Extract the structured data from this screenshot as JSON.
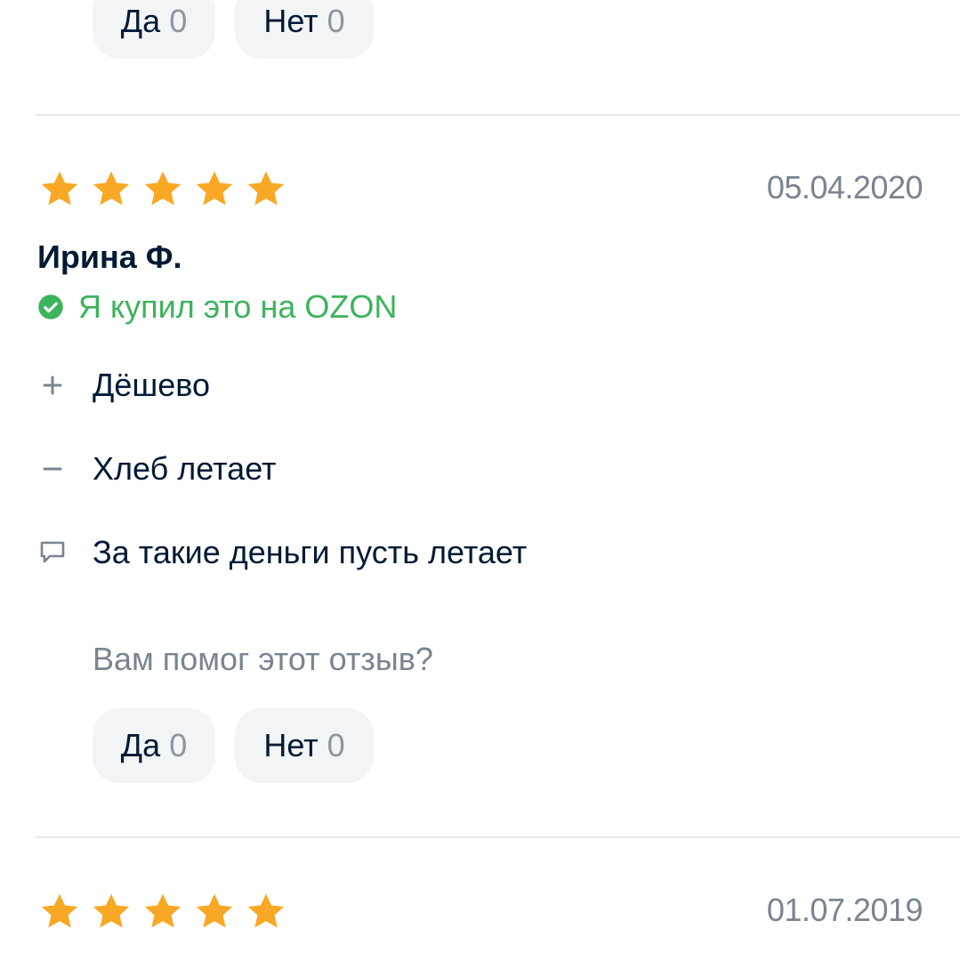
{
  "top_votes": {
    "yes_label": "Да",
    "yes_count": "0",
    "no_label": "Нет",
    "no_count": "0"
  },
  "review": {
    "rating": 5,
    "date": "05.04.2020",
    "author": "Ирина Ф.",
    "verified_text": "Я купил это на OZON",
    "pros": "Дёшево",
    "cons": "Хлеб летает",
    "comment": "За такие деньги пусть летает",
    "helpful_question": "Вам помог этот отзыв?",
    "yes_label": "Да",
    "yes_count": "0",
    "no_label": "Нет",
    "no_count": "0"
  },
  "next_review": {
    "rating": 5,
    "date": "01.07.2019"
  },
  "colors": {
    "star": "#f9a825",
    "verified": "#3cb35c",
    "muted": "#7a8490",
    "button_bg": "#f2f4f6"
  }
}
